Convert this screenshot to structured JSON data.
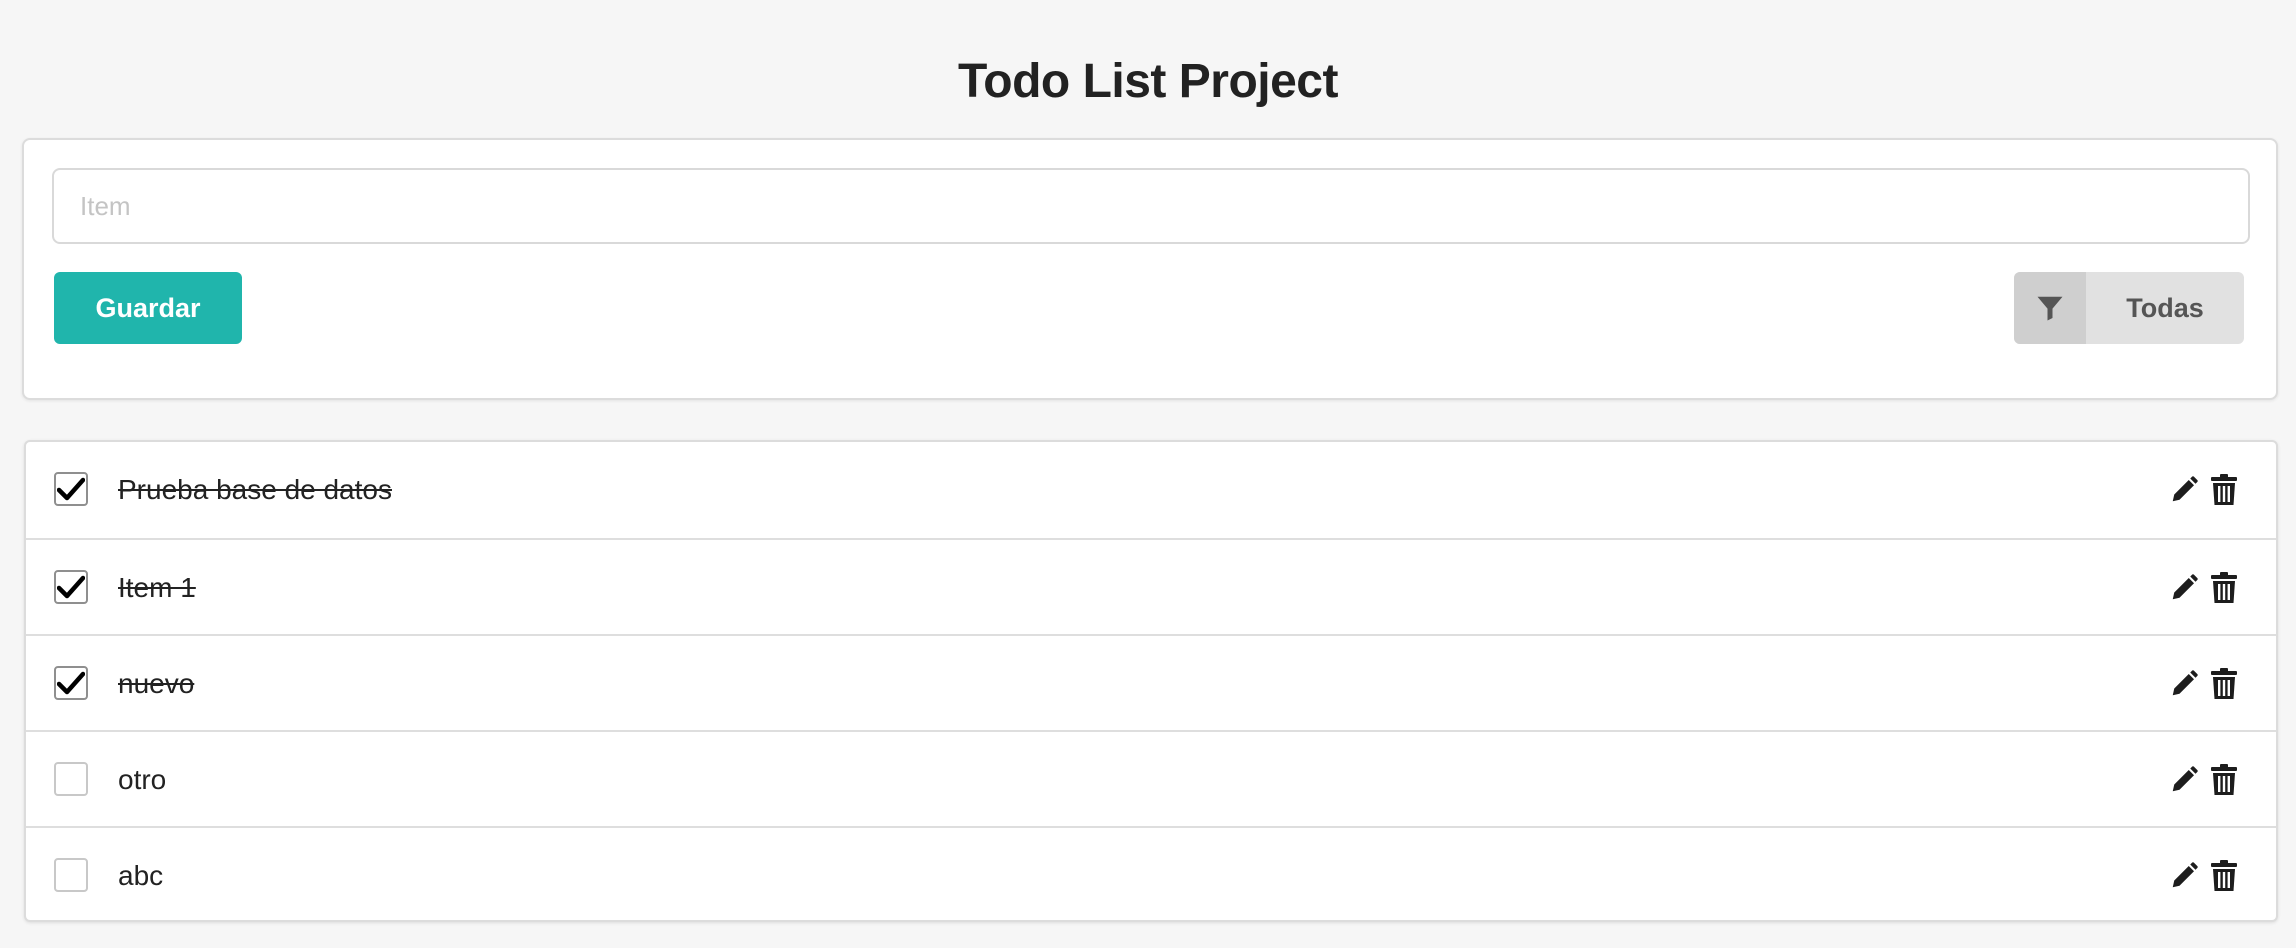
{
  "header": {
    "title": "Todo List Project"
  },
  "form": {
    "input_placeholder": "Item",
    "input_value": "",
    "save_label": "Guardar",
    "filter_icon": "filter-icon",
    "filter_label": "Todas"
  },
  "todos": [
    {
      "text": "Prueba base de datos",
      "completed": true
    },
    {
      "text": "Item 1",
      "completed": true
    },
    {
      "text": "nuevo",
      "completed": true
    },
    {
      "text": "otro",
      "completed": false
    },
    {
      "text": "abc",
      "completed": false
    }
  ],
  "row_icons": {
    "edit": "pencil-icon",
    "delete": "trash-icon"
  },
  "colors": {
    "background": "#f6f6f6",
    "accent": "#20b5ac",
    "filter_button": "#e1e1e1",
    "text": "#222222"
  }
}
